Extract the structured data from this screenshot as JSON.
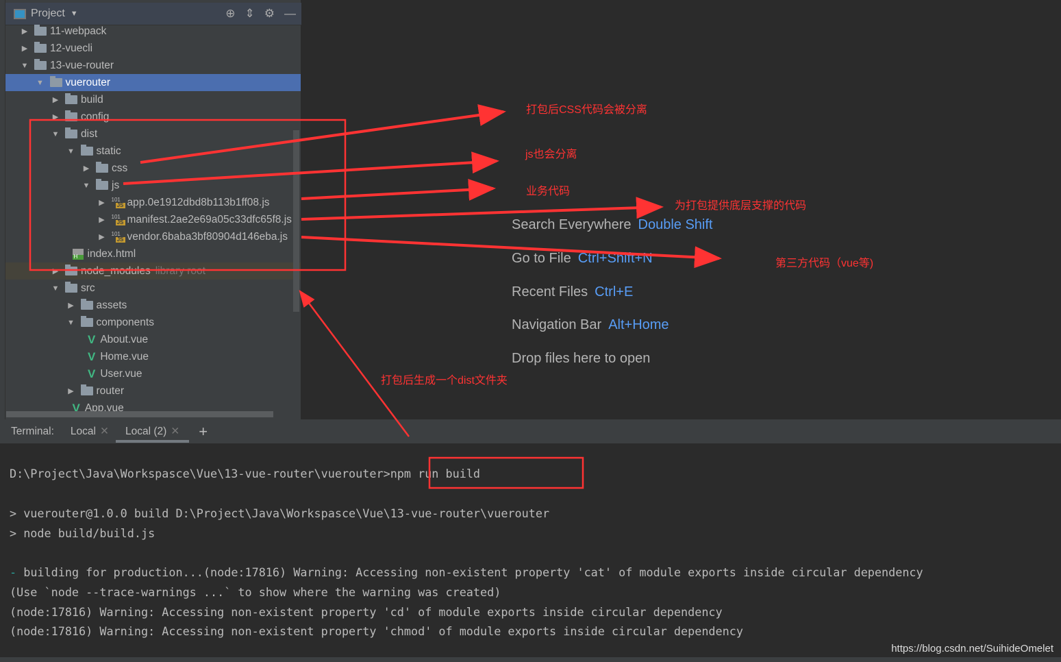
{
  "project_panel": {
    "title": "Project",
    "tools": [
      "locate-icon",
      "collapse-icon",
      "gear-icon",
      "minimize-icon"
    ]
  },
  "tree": [
    {
      "label": "11-webpack",
      "level": 0,
      "type": "folder",
      "state": "collapsed"
    },
    {
      "label": "12-vuecli",
      "level": 0,
      "type": "folder",
      "state": "collapsed"
    },
    {
      "label": "13-vue-router",
      "level": 0,
      "type": "folder",
      "state": "expanded"
    },
    {
      "label": "vuerouter",
      "level": 1,
      "type": "folder",
      "state": "expanded",
      "selected": true
    },
    {
      "label": "build",
      "level": 2,
      "type": "folder",
      "state": "collapsed"
    },
    {
      "label": "config",
      "level": 2,
      "type": "folder",
      "state": "collapsed"
    },
    {
      "label": "dist",
      "level": 2,
      "type": "folder",
      "state": "expanded"
    },
    {
      "label": "static",
      "level": 3,
      "type": "folder",
      "state": "expanded"
    },
    {
      "label": "css",
      "level": 4,
      "type": "folder",
      "state": "collapsed"
    },
    {
      "label": "js",
      "level": 4,
      "type": "folder",
      "state": "expanded"
    },
    {
      "label": "app.0e1912dbd8b113b1ff08.js",
      "level": 5,
      "type": "js",
      "state": "collapsed"
    },
    {
      "label": "manifest.2ae2e69a05c33dfc65f8.js",
      "level": 5,
      "type": "js",
      "state": "collapsed"
    },
    {
      "label": "vendor.6baba3bf80904d146eba.js",
      "level": 5,
      "type": "js",
      "state": "collapsed"
    },
    {
      "label": "index.html",
      "level": 3,
      "type": "html"
    },
    {
      "label": "node_modules",
      "suffix": "library root",
      "level": 2,
      "type": "folder",
      "state": "collapsed",
      "library": true
    },
    {
      "label": "src",
      "level": 2,
      "type": "folder",
      "state": "expanded"
    },
    {
      "label": "assets",
      "level": 3,
      "type": "folder",
      "state": "collapsed"
    },
    {
      "label": "components",
      "level": 3,
      "type": "folder",
      "state": "expanded"
    },
    {
      "label": "About.vue",
      "level": 4,
      "type": "vue"
    },
    {
      "label": "Home.vue",
      "level": 4,
      "type": "vue"
    },
    {
      "label": "User.vue",
      "level": 4,
      "type": "vue"
    },
    {
      "label": "router",
      "level": 3,
      "type": "folder",
      "state": "collapsed"
    },
    {
      "label": "App.vue",
      "level": 3,
      "type": "vue"
    }
  ],
  "welcome": [
    {
      "label": "Search Everywhere",
      "key": "Double Shift"
    },
    {
      "label": "Go to File",
      "key": "Ctrl+Shift+N"
    },
    {
      "label": "Recent Files",
      "key": "Ctrl+E"
    },
    {
      "label": "Navigation Bar",
      "key": "Alt+Home"
    },
    {
      "label": "Drop files here to open",
      "key": ""
    }
  ],
  "annotations": {
    "css": "打包后CSS代码会被分离",
    "js": "js也会分离",
    "app": "业务代码",
    "manifest": "为打包提供底层支撑的代码",
    "vendor": "第三方代码（vue等)",
    "dist": "打包后生成一个dist文件夹"
  },
  "terminal": {
    "label": "Terminal:",
    "tabs": [
      {
        "label": "Local",
        "active": false
      },
      {
        "label": "Local (2)",
        "active": true
      }
    ],
    "prompt": "D:\\Project\\Java\\Workspasce\\Vue\\13-vue-router\\vuerouter>",
    "command": "npm run build",
    "lines": [
      "> vuerouter@1.0.0 build D:\\Project\\Java\\Workspasce\\Vue\\13-vue-router\\vuerouter",
      "> node build/build.js",
      "building for production...(node:17816) Warning: Accessing non-existent property 'cat' of module exports inside circular dependency",
      "(Use `node --trace-warnings ...` to show where the warning was created)",
      "(node:17816) Warning: Accessing non-existent property 'cd' of module exports inside circular dependency",
      "(node:17816) Warning: Accessing non-existent property 'chmod' of module exports inside circular dependency"
    ],
    "spinner": "-"
  },
  "watermark": "https://blog.csdn.net/SuihideOmelet",
  "colors": {
    "annotation": "#ff3333",
    "selection": "#4b6eaf",
    "shortcut": "#589df6"
  }
}
